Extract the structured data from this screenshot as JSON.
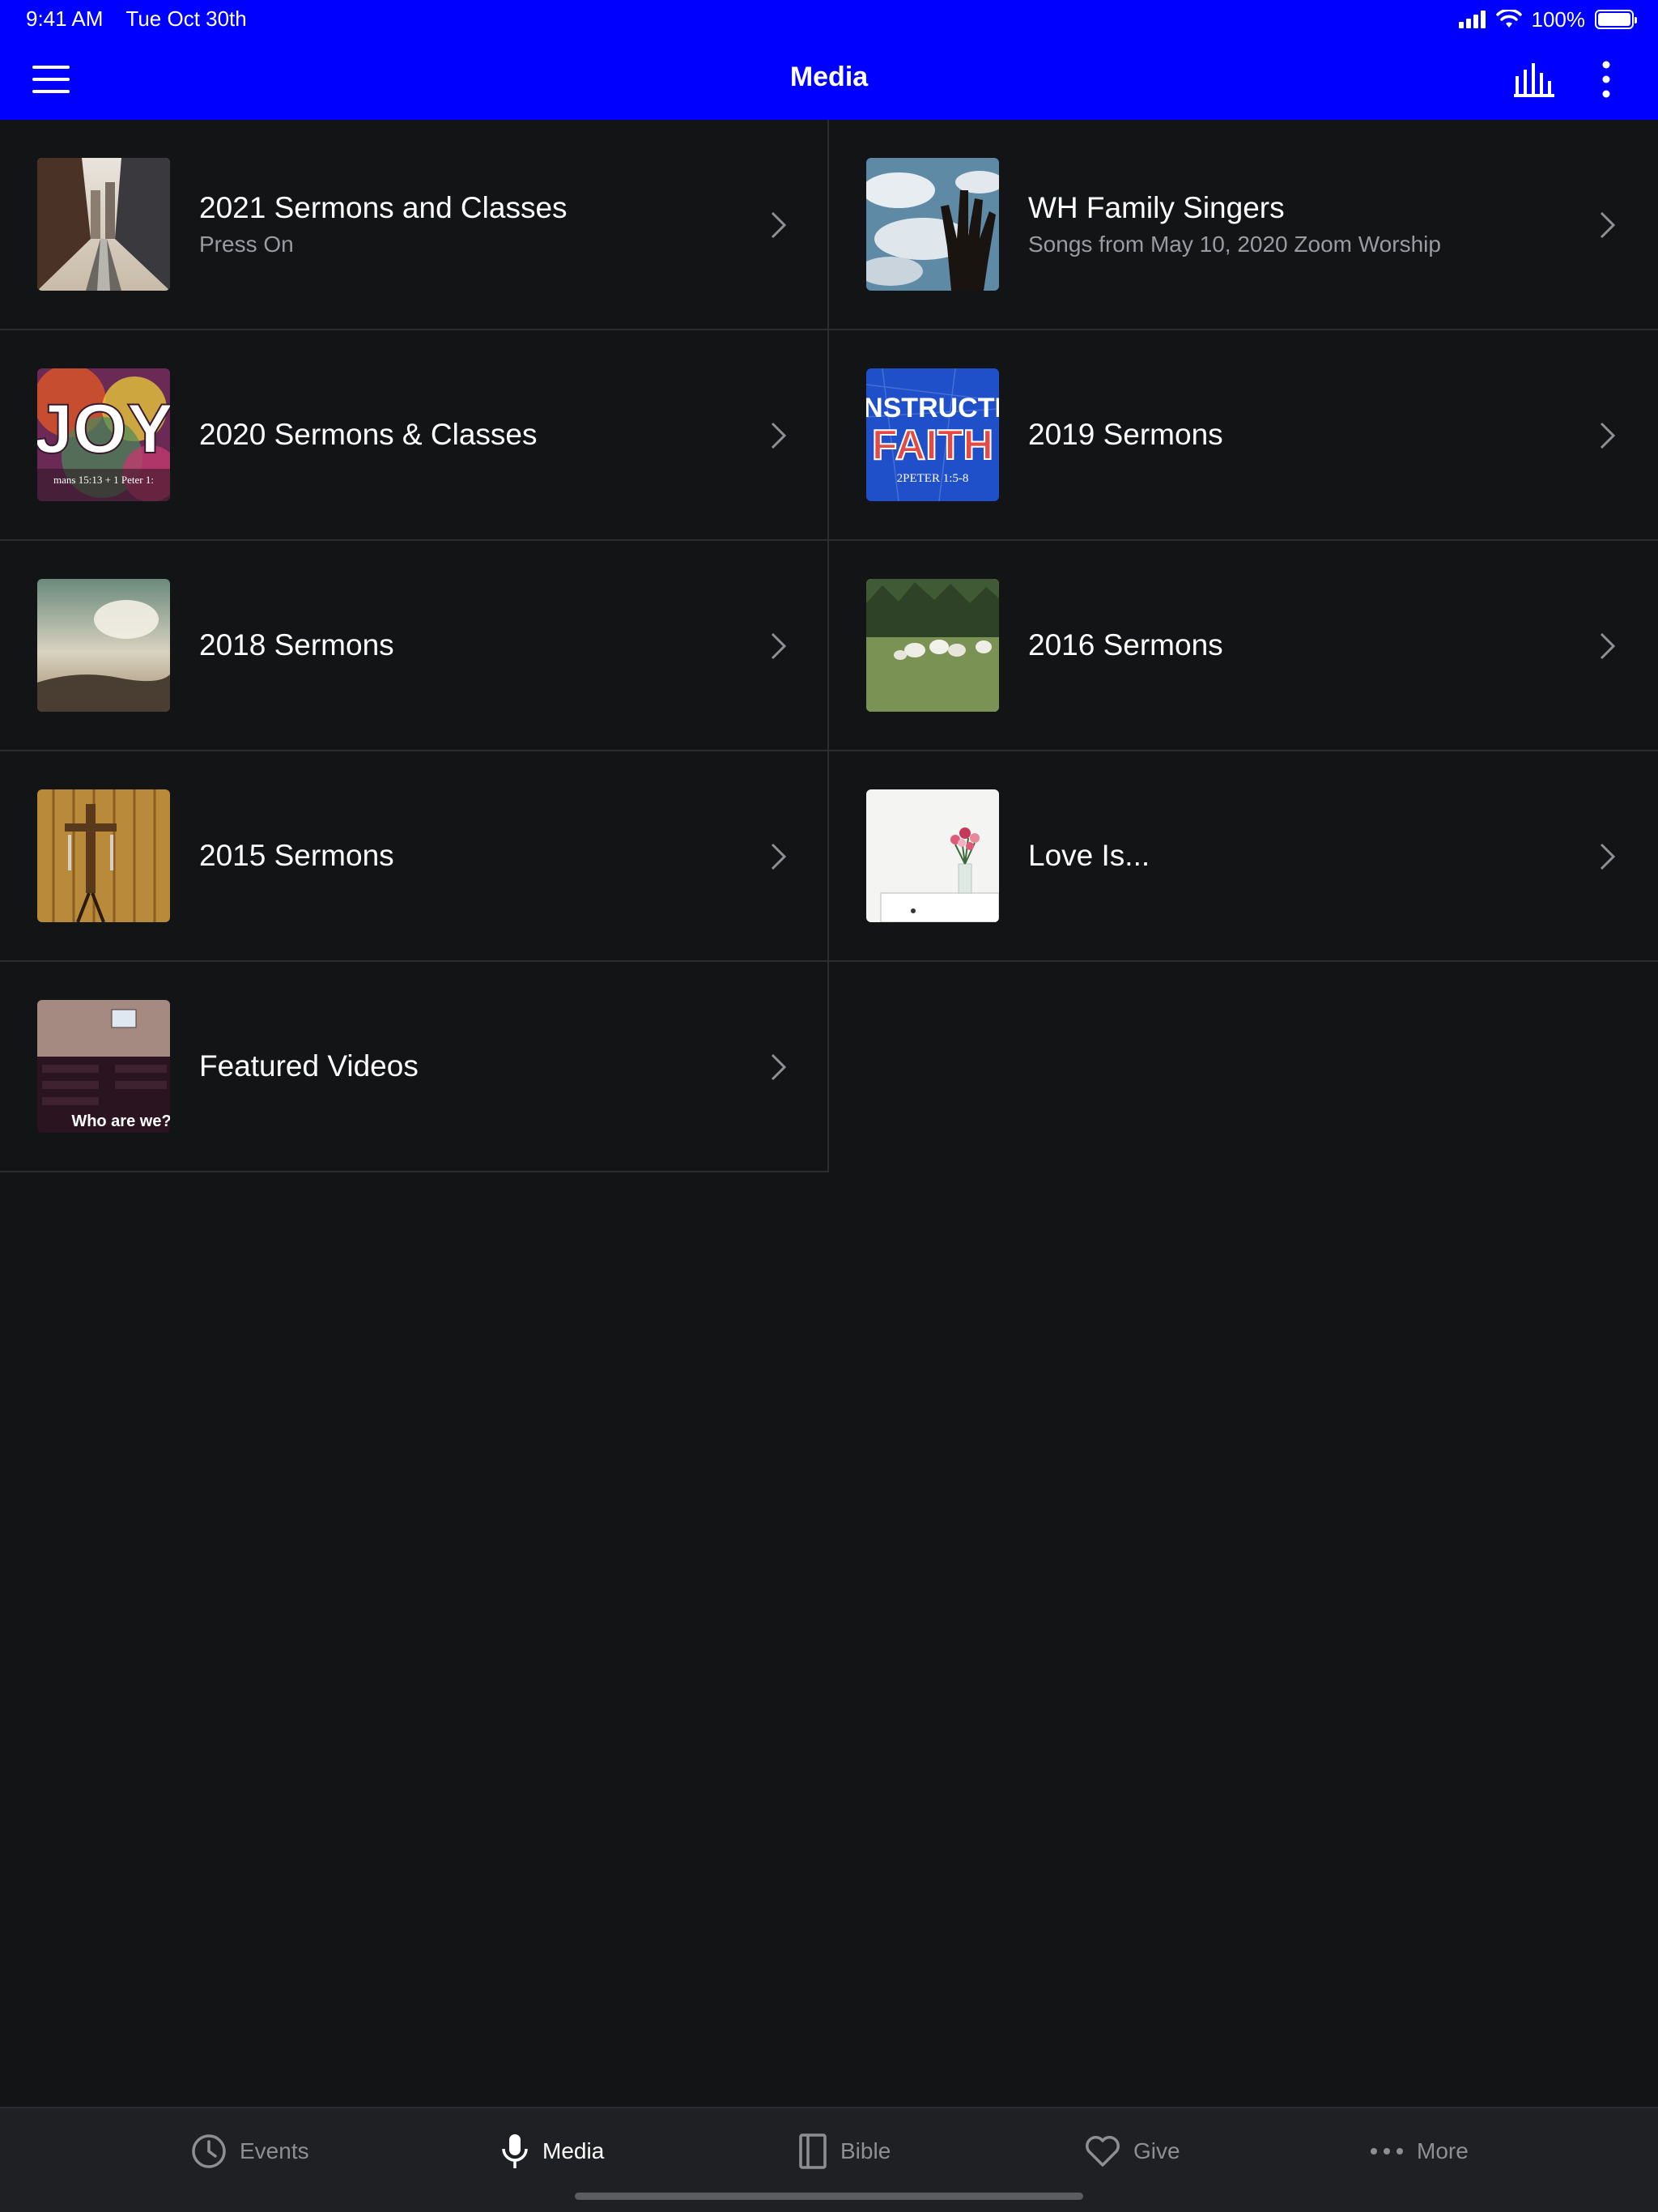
{
  "status_bar": {
    "time": "9:41 AM",
    "date": "Tue Oct 30th",
    "battery_label": "100%",
    "battery_level": 1.0,
    "icons": [
      "signal-icon",
      "wifi-icon",
      "battery-icon"
    ]
  },
  "nav_bar": {
    "title": "Media",
    "background_color": "#0000ff",
    "left_icon": "hamburger-menu-icon",
    "right_icons": [
      "equalizer-icon",
      "more-vertical-icon"
    ]
  },
  "media_items": [
    {
      "title": "2021 Sermons and Classes",
      "subtitle": "Press On",
      "thumbnail": "city-street-image"
    },
    {
      "title": "WH Family Singers",
      "subtitle": "Songs from May 10, 2020 Zoom Worship",
      "thumbnail": "hand-clouds-image"
    },
    {
      "title": "2020 Sermons & Classes",
      "subtitle": "",
      "thumbnail": "joy-image",
      "thumb_text": {
        "big": "JOY",
        "small": "mans 15:13 + 1 Peter 1:"
      }
    },
    {
      "title": "2019 Sermons",
      "subtitle": "",
      "thumbnail": "constructive-faith-image",
      "thumb_text": {
        "line1": "NSTRUCTI",
        "line2": "FAITH",
        "ref": "2PETER 1:5-8"
      }
    },
    {
      "title": "2018 Sermons",
      "subtitle": "",
      "thumbnail": "sky-landscape-image"
    },
    {
      "title": "2016 Sermons",
      "subtitle": "",
      "thumbnail": "sheep-field-image"
    },
    {
      "title": "2015 Sermons",
      "subtitle": "",
      "thumbnail": "cross-wall-image"
    },
    {
      "title": "Love Is...",
      "subtitle": "",
      "thumbnail": "flowers-vase-image"
    },
    {
      "title": "Featured Videos",
      "subtitle": "",
      "thumbnail": "church-interior-image",
      "thumb_text": {
        "caption": "Who are we?"
      }
    }
  ],
  "tab_bar": {
    "tabs": [
      {
        "label": "Events",
        "icon": "clock-icon",
        "active": false
      },
      {
        "label": "Media",
        "icon": "microphone-icon",
        "active": true
      },
      {
        "label": "Bible",
        "icon": "book-icon",
        "active": false
      },
      {
        "label": "Give",
        "icon": "heart-icon",
        "active": false
      },
      {
        "label": "More",
        "icon": "more-horizontal-icon",
        "active": false
      }
    ]
  }
}
